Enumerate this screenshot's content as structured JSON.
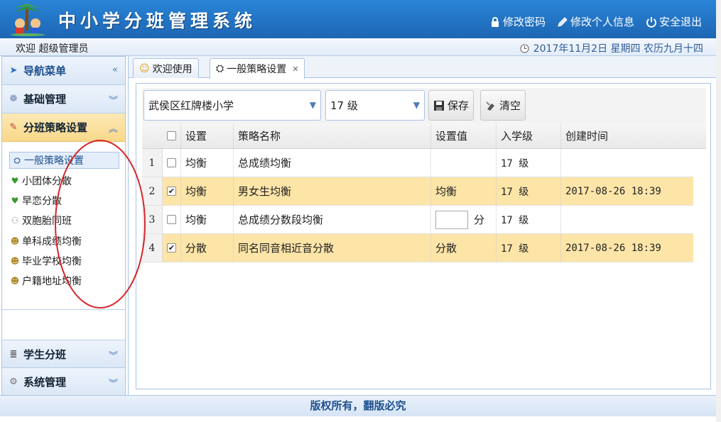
{
  "header": {
    "title": "中小学分班管理系统",
    "actions": [
      "修改密码",
      "修改个人信息",
      "安全退出"
    ]
  },
  "welcome": {
    "text": "欢迎 超级管理员",
    "date": "2017年11月2日 星期四 农历九月十四"
  },
  "sidebar": {
    "nav_title": "导航菜单",
    "panels": [
      "基础管理",
      "分班策略设置",
      "学生分班",
      "系统管理"
    ],
    "strategy_items": [
      "一般策略设置",
      "小团体分散",
      "早恋分散",
      "双胞胎同班",
      "单科成绩均衡",
      "毕业学校均衡",
      "户籍地址均衡"
    ]
  },
  "tabs": [
    "欢迎使用",
    "一般策略设置"
  ],
  "toolbar": {
    "school": "武侯区红牌楼小学",
    "grade": "17 级",
    "save": "保存",
    "clear": "清空"
  },
  "grid": {
    "columns": [
      "设置",
      "策略名称",
      "设置值",
      "入学级",
      "创建时间"
    ],
    "rows": [
      {
        "num": "1",
        "checked": false,
        "setting": "均衡",
        "name": "总成绩均衡",
        "value": "",
        "grade": "17 级",
        "created": ""
      },
      {
        "num": "2",
        "checked": true,
        "setting": "均衡",
        "name": "男女生均衡",
        "value": "均衡",
        "grade": "17 级",
        "created": "2017-08-26 18:39"
      },
      {
        "num": "3",
        "checked": false,
        "setting": "均衡",
        "name": "总成绩分数段均衡",
        "value": "分",
        "grade": "17 级",
        "created": ""
      },
      {
        "num": "4",
        "checked": true,
        "setting": "分散",
        "name": "同名同音相近音分散",
        "value": "分散",
        "grade": "17 级",
        "created": "2017-08-26 18:39"
      }
    ]
  },
  "footer": "版权所有，翻版必究",
  "colors": {
    "header": "#2272c2",
    "highlight_row": "#fde5a8",
    "active_panel": "#f8d88a",
    "annotation": "#d8252a"
  }
}
